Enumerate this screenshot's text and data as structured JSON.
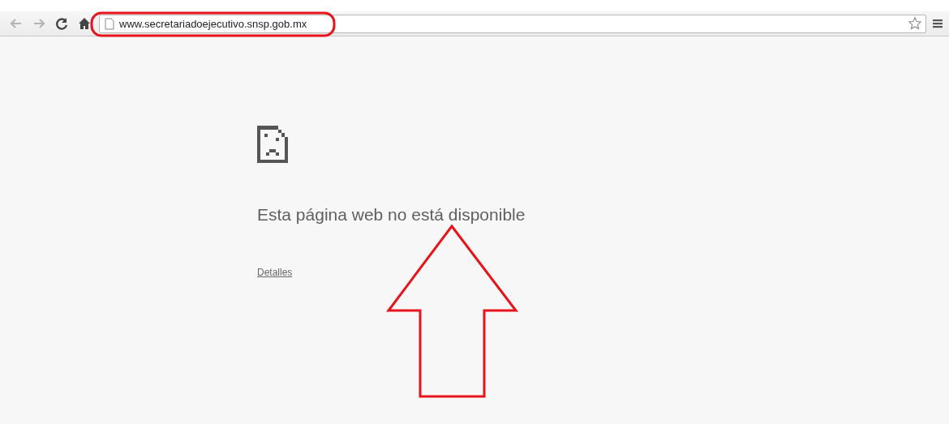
{
  "toolbar": {
    "url": "www.secretariadoejecutivo.snsp.gob.mx"
  },
  "error_page": {
    "heading": "Esta página web no está disponible",
    "details_link": "Detalles"
  },
  "annotations": {
    "url_circled": true,
    "arrow_shown": true
  }
}
